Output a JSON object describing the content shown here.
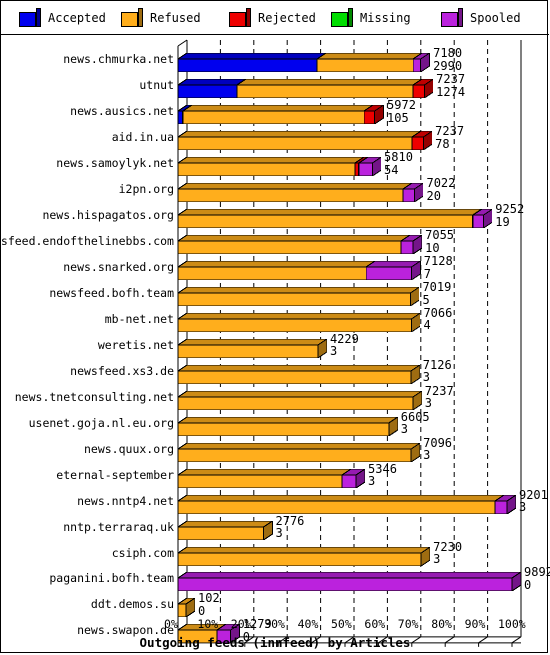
{
  "legend": {
    "items": [
      {
        "label": "Accepted",
        "color": "#0000ee",
        "icon": "cube-icon"
      },
      {
        "label": "Refused",
        "color": "#ffae1c",
        "icon": "cube-icon"
      },
      {
        "label": "Rejected",
        "color": "#ee0000",
        "icon": "cube-icon"
      },
      {
        "label": "Missing",
        "color": "#00dd00",
        "icon": "cube-icon"
      },
      {
        "label": "Spooled",
        "color": "#bb22dd",
        "icon": "cube-icon"
      }
    ]
  },
  "chart_data": {
    "type": "bar",
    "orientation": "horizontal",
    "stacked": true,
    "title": "Outgoing feeds (innfeed) by Articles",
    "xlabel": "Outgoing feeds (innfeed) by Articles",
    "ylabel": "",
    "xlim": [
      0,
      100
    ],
    "xticks": [
      "0%",
      "10%",
      "20%",
      "30%",
      "40%",
      "50%",
      "60%",
      "70%",
      "80%",
      "90%",
      "100%"
    ],
    "grid": true,
    "legend_position": "top",
    "series_names": [
      "Accepted",
      "Refused",
      "Rejected",
      "Missing",
      "Spooled"
    ],
    "categories": [
      "news.chmurka.net",
      "utnut",
      "news.ausics.net",
      "aid.in.ua",
      "news.samoylyk.net",
      "i2pn.org",
      "news.hispagatos.org",
      "newsfeed.endofthelinebbs.com",
      "news.snarked.org",
      "newsfeed.bofh.team",
      "mb-net.net",
      "weretis.net",
      "newsfeed.xs3.de",
      "news.tnetconsulting.net",
      "usenet.goja.nl.eu.org",
      "news.quux.org",
      "eternal-september",
      "news.nntp4.net",
      "nntp.terraraq.uk",
      "csiph.com",
      "paganini.bofh.team",
      "ddt.demos.su",
      "news.swapon.de"
    ],
    "rows": [
      {
        "name": "news.chmurka.net",
        "total": 7180,
        "second": 2990,
        "segments": [
          {
            "s": "Accepted",
            "pct": 41.6
          },
          {
            "s": "Refused",
            "pct": 28.9
          },
          {
            "s": "Spooled",
            "pct": 2.3
          }
        ]
      },
      {
        "name": "utnut",
        "total": 7237,
        "second": 1274,
        "segments": [
          {
            "s": "Accepted",
            "pct": 17.6
          },
          {
            "s": "Refused",
            "pct": 52.7
          },
          {
            "s": "Rejected",
            "pct": 3.4
          }
        ]
      },
      {
        "name": "news.ausics.net",
        "total": 5972,
        "second": 105,
        "segments": [
          {
            "s": "Accepted",
            "pct": 1.4
          },
          {
            "s": "Refused",
            "pct": 54.4
          },
          {
            "s": "Rejected",
            "pct": 3.2
          }
        ]
      },
      {
        "name": "aid.in.ua",
        "total": 7237,
        "second": 78,
        "segments": [
          {
            "s": "Refused",
            "pct": 70.0
          },
          {
            "s": "Rejected",
            "pct": 3.4
          }
        ]
      },
      {
        "name": "news.samoylyk.net",
        "total": 5810,
        "second": 54,
        "segments": [
          {
            "s": "Refused",
            "pct": 53.0
          },
          {
            "s": "Rejected",
            "pct": 1.1
          },
          {
            "s": "Spooled",
            "pct": 4.0
          }
        ]
      },
      {
        "name": "i2pn.org",
        "total": 7022,
        "second": 20,
        "segments": [
          {
            "s": "Refused",
            "pct": 67.4
          },
          {
            "s": "Spooled",
            "pct": 3.4
          }
        ]
      },
      {
        "name": "news.hispagatos.org",
        "total": 9252,
        "second": 19,
        "segments": [
          {
            "s": "Refused",
            "pct": 88.2
          },
          {
            "s": "Spooled",
            "pct": 3.2
          }
        ]
      },
      {
        "name": "newsfeed.endofthelinebbs.com",
        "total": 7055,
        "second": 10,
        "segments": [
          {
            "s": "Refused",
            "pct": 66.8
          },
          {
            "s": "Spooled",
            "pct": 3.6
          }
        ]
      },
      {
        "name": "news.snarked.org",
        "total": 7128,
        "second": 7,
        "segments": [
          {
            "s": "Refused",
            "pct": 56.4
          },
          {
            "s": "Spooled",
            "pct": 13.6
          }
        ]
      },
      {
        "name": "newsfeed.bofh.team",
        "total": 7019,
        "second": 5,
        "segments": [
          {
            "s": "Refused",
            "pct": 69.6
          }
        ]
      },
      {
        "name": "mb-net.net",
        "total": 7066,
        "second": 4,
        "segments": [
          {
            "s": "Refused",
            "pct": 69.9
          }
        ]
      },
      {
        "name": "weretis.net",
        "total": 4229,
        "second": 3,
        "segments": [
          {
            "s": "Refused",
            "pct": 41.9
          }
        ]
      },
      {
        "name": "newsfeed.xs3.de",
        "total": 7126,
        "second": 3,
        "segments": [
          {
            "s": "Refused",
            "pct": 69.7
          }
        ]
      },
      {
        "name": "news.tnetconsulting.net",
        "total": 7237,
        "second": 3,
        "segments": [
          {
            "s": "Refused",
            "pct": 70.3
          }
        ]
      },
      {
        "name": "usenet.goja.nl.eu.org",
        "total": 6605,
        "second": 3,
        "segments": [
          {
            "s": "Refused",
            "pct": 63.1
          }
        ]
      },
      {
        "name": "news.quux.org",
        "total": 7096,
        "second": 3,
        "segments": [
          {
            "s": "Refused",
            "pct": 69.8
          }
        ]
      },
      {
        "name": "eternal-september",
        "total": 5346,
        "second": 3,
        "segments": [
          {
            "s": "Refused",
            "pct": 49.1
          },
          {
            "s": "Spooled",
            "pct": 4.2
          }
        ]
      },
      {
        "name": "news.nntp4.net",
        "total": 9201,
        "second": 3,
        "segments": [
          {
            "s": "Refused",
            "pct": 94.9
          },
          {
            "s": "Spooled",
            "pct": 3.6
          }
        ]
      },
      {
        "name": "nntp.terraraq.uk",
        "total": 2776,
        "second": 3,
        "segments": [
          {
            "s": "Refused",
            "pct": 25.6
          }
        ]
      },
      {
        "name": "csiph.com",
        "total": 7230,
        "second": 3,
        "segments": [
          {
            "s": "Refused",
            "pct": 72.8
          }
        ]
      },
      {
        "name": "paganini.bofh.team",
        "total": 9892,
        "second": 0,
        "segments": [
          {
            "s": "Spooled",
            "pct": 100.0
          }
        ]
      },
      {
        "name": "ddt.demos.su",
        "total": 102,
        "second": 0,
        "segments": [
          {
            "s": "Refused",
            "pct": 2.4
          }
        ]
      },
      {
        "name": "news.swapon.de",
        "total": 1279,
        "second": 0,
        "segments": [
          {
            "s": "Refused",
            "pct": 11.7
          },
          {
            "s": "Spooled",
            "pct": 4.1
          }
        ]
      }
    ]
  }
}
